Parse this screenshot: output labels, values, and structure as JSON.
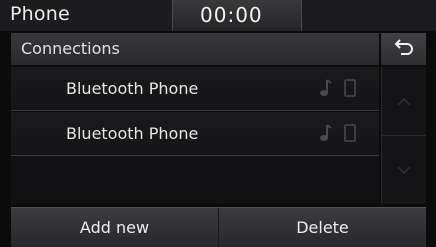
{
  "status": {
    "app_title": "Phone",
    "clock": "00:00"
  },
  "header": {
    "title": "Connections",
    "back_icon": "back-arrow-icon"
  },
  "devices": [
    {
      "label": "Bluetooth Phone",
      "icons": [
        "music-note-icon",
        "phone-icon"
      ]
    },
    {
      "label": "Bluetooth Phone",
      "icons": [
        "music-note-icon",
        "phone-icon"
      ]
    }
  ],
  "scroll": {
    "up_icon": "chevron-up-icon",
    "down_icon": "chevron-down-icon"
  },
  "actions": {
    "add_new": "Add new",
    "delete": "Delete"
  },
  "colors": {
    "background": "#0b0b0c",
    "bar": "#2e2e31",
    "text": "#e8e8e8",
    "dim_icon": "#3a3a3d"
  }
}
